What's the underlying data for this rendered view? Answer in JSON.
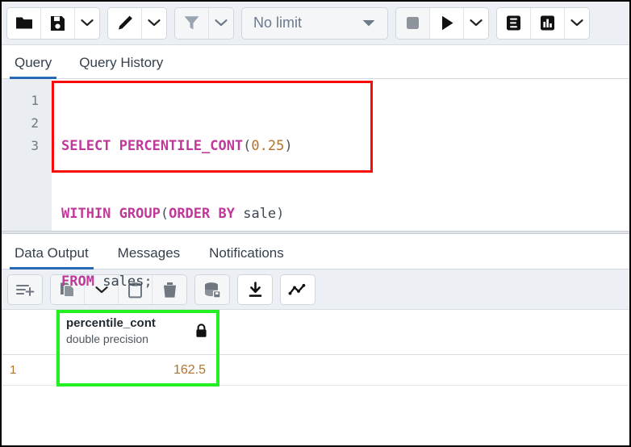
{
  "toolbar": {
    "groups": [
      {
        "name": "file-group",
        "buttons": [
          {
            "name": "open-file-button",
            "icon": "folder-icon"
          },
          {
            "name": "save-file-button",
            "icon": "save-icon"
          },
          {
            "name": "save-file-dropdown",
            "icon": "chevron-down-icon"
          }
        ]
      },
      {
        "name": "edit-group",
        "buttons": [
          {
            "name": "edit-button",
            "icon": "pencil-icon"
          },
          {
            "name": "edit-dropdown",
            "icon": "chevron-down-icon"
          }
        ]
      },
      {
        "name": "filter-group",
        "buttons": [
          {
            "name": "filter-button",
            "icon": "funnel-icon"
          },
          {
            "name": "filter-dropdown",
            "icon": "chevron-down-icon"
          }
        ]
      }
    ],
    "limit": {
      "label": "No limit",
      "icon": "caret-down-icon"
    },
    "execute_group": [
      {
        "name": "stop-button",
        "icon": "stop-square-icon"
      },
      {
        "name": "execute-button",
        "icon": "play-icon"
      },
      {
        "name": "execute-dropdown",
        "icon": "chevron-down-icon"
      }
    ],
    "explain_group": [
      {
        "name": "explain-button",
        "icon": "explain-e-icon"
      },
      {
        "name": "explain-analyze-button",
        "icon": "bar-chart-icon"
      },
      {
        "name": "explain-dropdown",
        "icon": "chevron-down-icon"
      }
    ]
  },
  "query_tabs": [
    {
      "label": "Query",
      "active": true
    },
    {
      "label": "Query History",
      "active": false
    }
  ],
  "editor": {
    "line_numbers": [
      "1",
      "2",
      "3"
    ],
    "lines": [
      [
        {
          "text": "SELECT PERCENTILE_CONT",
          "type": "kw"
        },
        {
          "text": "(",
          "type": "punc"
        },
        {
          "text": "0.25",
          "type": "num"
        },
        {
          "text": ")",
          "type": "punc"
        }
      ],
      [
        {
          "text": "WITHIN GROUP",
          "type": "kw"
        },
        {
          "text": "(",
          "type": "punc"
        },
        {
          "text": "ORDER BY",
          "type": "kw"
        },
        {
          "text": " ",
          "type": "punc"
        },
        {
          "text": "sale",
          "type": "id"
        },
        {
          "text": ")",
          "type": "punc"
        }
      ],
      [
        {
          "text": "FROM",
          "type": "kw"
        },
        {
          "text": " ",
          "type": "punc"
        },
        {
          "text": "sales",
          "type": "id"
        },
        {
          "text": ";",
          "type": "punc"
        }
      ]
    ],
    "sql_text": "SELECT PERCENTILE_CONT(0.25)\nWITHIN GROUP(ORDER BY sale)\nFROM sales;",
    "highlight_color": "#fa0b0b"
  },
  "output_tabs": [
    {
      "label": "Data Output",
      "active": true
    },
    {
      "label": "Messages",
      "active": false
    },
    {
      "label": "Notifications",
      "active": false
    }
  ],
  "result_toolbar": [
    {
      "name": "add-row-button",
      "icon": "add-row-icon"
    },
    {
      "name": "copy-button",
      "icon": "copy-icon"
    },
    {
      "name": "copy-dropdown",
      "icon": "chevron-down-icon"
    },
    {
      "name": "paste-button",
      "icon": "clipboard-icon"
    },
    {
      "name": "delete-row-button",
      "icon": "trash-icon"
    },
    {
      "name": "save-data-changes-button",
      "icon": "save-database-icon"
    },
    {
      "name": "download-results-button",
      "icon": "download-icon"
    },
    {
      "name": "graph-visualiser-button",
      "icon": "line-graph-icon"
    }
  ],
  "grid": {
    "columns": [
      {
        "name": "percentile_cont",
        "type": "double precision",
        "lock": "lock-icon"
      }
    ],
    "rows": [
      {
        "number": "1",
        "values": [
          "162.5"
        ]
      }
    ],
    "highlight_color": "#22f022"
  }
}
